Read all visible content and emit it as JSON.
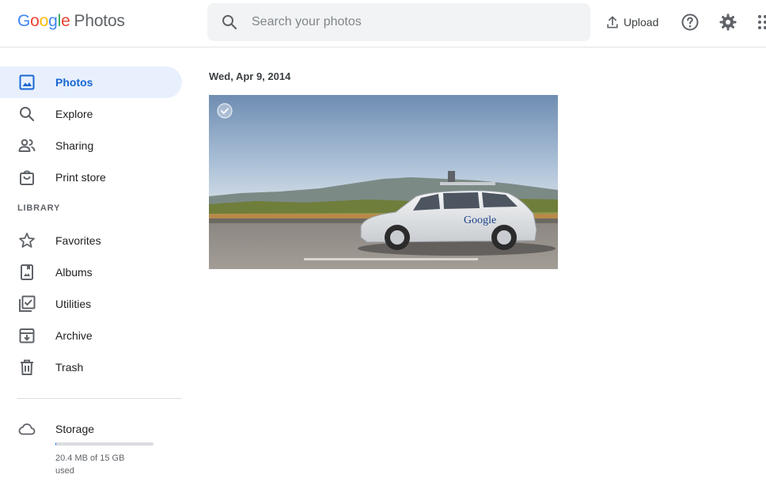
{
  "header": {
    "logo_word": [
      "G",
      "o",
      "o",
      "g",
      "l",
      "e"
    ],
    "product": "Photos",
    "search_placeholder": "Search your photos",
    "upload_label": "Upload"
  },
  "sidebar": {
    "primary": [
      {
        "label": "Photos",
        "icon": "photo-icon",
        "active": true
      },
      {
        "label": "Explore",
        "icon": "search-icon"
      },
      {
        "label": "Sharing",
        "icon": "people-icon"
      },
      {
        "label": "Print store",
        "icon": "shopping-bag-icon"
      }
    ],
    "library_heading": "LIBRARY",
    "library": [
      {
        "label": "Favorites",
        "icon": "star-icon"
      },
      {
        "label": "Albums",
        "icon": "album-icon"
      },
      {
        "label": "Utilities",
        "icon": "checklist-icon"
      },
      {
        "label": "Archive",
        "icon": "archive-icon"
      },
      {
        "label": "Trash",
        "icon": "trash-icon"
      }
    ],
    "storage": {
      "label": "Storage",
      "used_text": "20.4 MB of 15 GB",
      "used_suffix": "used",
      "fraction_used": 0.0013
    }
  },
  "main": {
    "groups": [
      {
        "date": "Wed, Apr 9, 2014",
        "photos": [
          {
            "logo_on_car": "Google"
          }
        ]
      }
    ]
  },
  "colors": {
    "accent": "#1a73e8",
    "active_bg": "#e8f0fe",
    "active_text": "#1967d2",
    "search_bg": "#f1f3f4"
  }
}
